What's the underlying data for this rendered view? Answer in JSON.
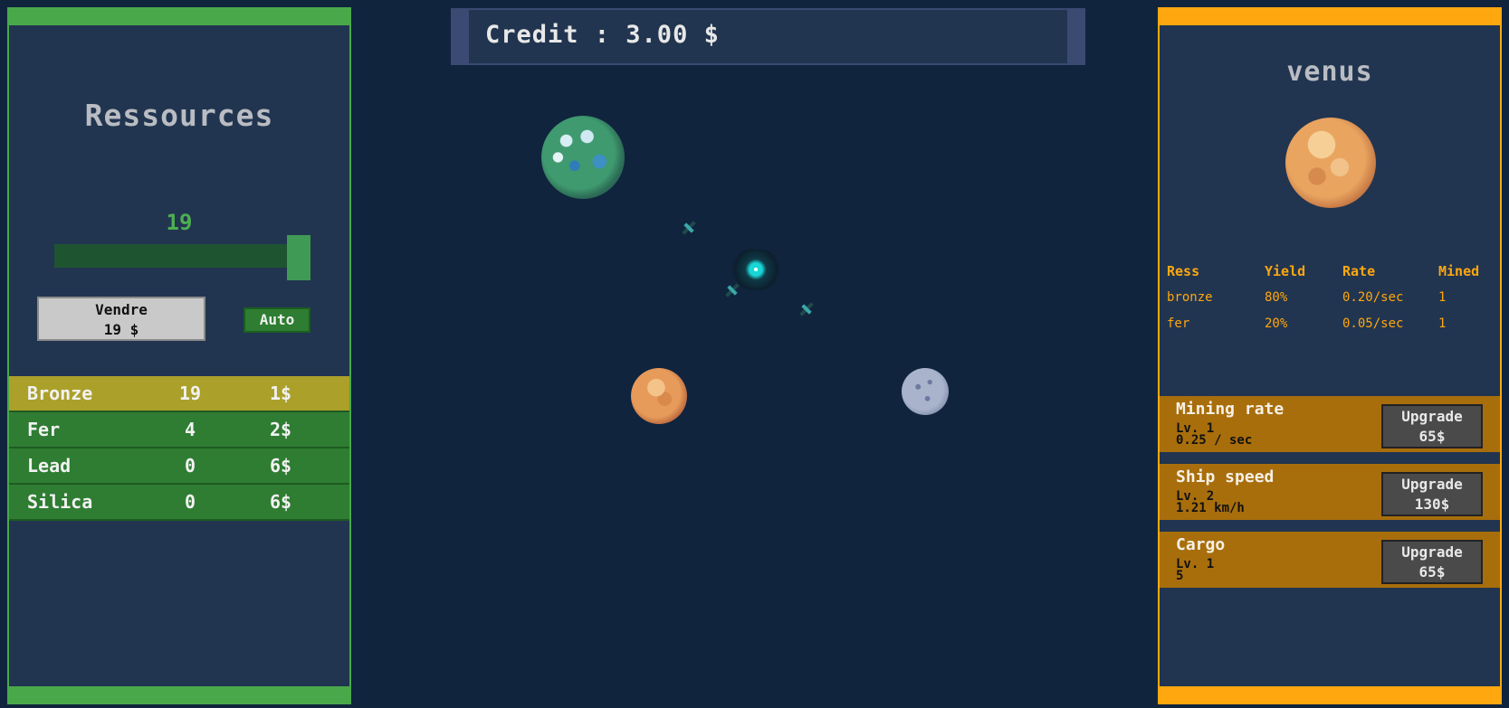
{
  "credit": {
    "text": "Credit : 3.00 $"
  },
  "resources_panel": {
    "title": "Ressources",
    "sell_quantity": "19",
    "slider_fraction": 1.0,
    "sell_button": {
      "label": "Vendre",
      "price": "19 $"
    },
    "auto_button": "Auto",
    "rows": [
      {
        "name": "Bronze",
        "qty": "19",
        "price": "1$",
        "selected": true
      },
      {
        "name": "Fer",
        "qty": "4",
        "price": "2$",
        "selected": false
      },
      {
        "name": "Lead",
        "qty": "0",
        "price": "6$",
        "selected": false
      },
      {
        "name": "Silica",
        "qty": "0",
        "price": "6$",
        "selected": false
      }
    ]
  },
  "planet_panel": {
    "name": "venus",
    "table": {
      "headers": [
        "Ress",
        "Yield",
        "Rate",
        "Mined"
      ],
      "rows": [
        [
          "bronze",
          "80%",
          "0.20/sec",
          "1"
        ],
        [
          "fer",
          "20%",
          "0.05/sec",
          "1"
        ]
      ]
    },
    "upgrades": [
      {
        "title": "Mining rate",
        "level": "Lv. 1",
        "value": "0.25 / sec",
        "button_label": "Upgrade",
        "button_price": "65$"
      },
      {
        "title": "Ship speed",
        "level": "Lv. 2",
        "value": "1.21 km/h",
        "button_label": "Upgrade",
        "button_price": "130$"
      },
      {
        "title": "Cargo",
        "level": "Lv. 1",
        "value": "5",
        "button_label": "Upgrade",
        "button_price": "65$"
      }
    ]
  },
  "colors": {
    "left_accent": "#49a94a",
    "right_accent": "#ffa70f",
    "selected_row": "#aba02a",
    "row_green": "#2e7d32",
    "background": "#10243e"
  }
}
